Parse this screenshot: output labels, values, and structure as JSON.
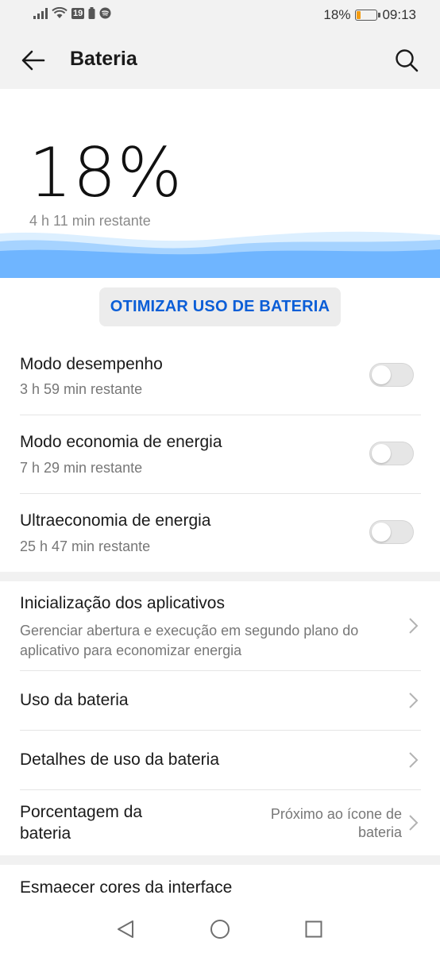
{
  "status_bar": {
    "network_badge": "19",
    "battery_percent": "18%",
    "battery_level": 0.18,
    "time": "09:13"
  },
  "app_bar": {
    "title": "Bateria",
    "back_icon": "back-arrow-icon",
    "search_icon": "search-icon"
  },
  "hero": {
    "percent": "18%",
    "remaining": "4 h 11 min restante",
    "wave_colors": [
      "#dcefff",
      "#a6d3ff",
      "#6fb5ff"
    ]
  },
  "optimize_button": "OTIMIZAR USO DE BATERIA",
  "modes": [
    {
      "title": "Modo desempenho",
      "subtitle": "3 h 59 min restante",
      "enabled": false
    },
    {
      "title": "Modo economia de energia",
      "subtitle": "7 h 29 min restante",
      "enabled": false
    },
    {
      "title": "Ultraeconomia de energia",
      "subtitle": "25 h 47 min restante",
      "enabled": false
    }
  ],
  "settings": [
    {
      "title": "Inicialização dos aplicativos",
      "subtitle_line1": "Gerenciar abertura e execução em segundo plano do",
      "subtitle_line2": "aplicativo para economizar energia"
    },
    {
      "title": "Uso da bateria"
    },
    {
      "title": "Detalhes de uso da bateria"
    },
    {
      "title_line1": "Porcentagem da",
      "title_line2": "bateria",
      "value_line1": "Próximo ao ícone de",
      "value_line2": "bateria"
    },
    {
      "title": "Esmaecer cores da interface"
    }
  ],
  "nav_bar": {
    "back_icon": "triangle-back-icon",
    "home_icon": "circle-home-icon",
    "recents_icon": "square-recents-icon"
  },
  "colors": {
    "accent": "#0b5ed7",
    "battery_low": "#f39c12"
  }
}
